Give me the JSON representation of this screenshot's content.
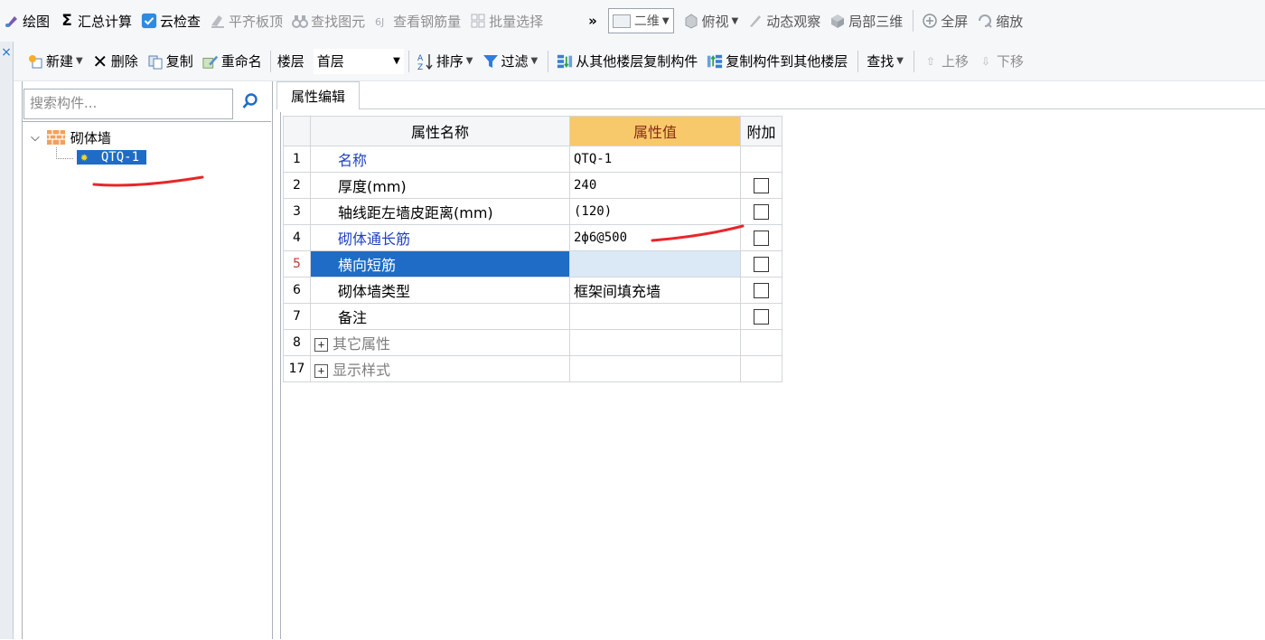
{
  "toolbar1": {
    "items": [
      {
        "label": "绘图",
        "icon": "draw-icon",
        "disabled": false
      },
      {
        "label": "汇总计算",
        "icon": "sigma-icon",
        "disabled": false
      },
      {
        "label": "云检查",
        "icon": "cloud-check-icon",
        "disabled": false
      },
      {
        "label": "平齐板顶",
        "icon": "align-slab-icon",
        "disabled": true
      },
      {
        "label": "查找图元",
        "icon": "binoculars-icon",
        "disabled": true
      },
      {
        "label": "查看钢筋量",
        "icon": "rebar-view-icon",
        "disabled": true
      },
      {
        "label": "批量选择",
        "icon": "batch-select-icon",
        "disabled": true
      }
    ],
    "overflow": "»",
    "view_mode": "二维",
    "view_items": [
      {
        "label": "俯视",
        "icon": "top-view-icon",
        "has_caret": true
      },
      {
        "label": "动态观察",
        "icon": "orbit-icon",
        "has_caret": false
      },
      {
        "label": "局部三维",
        "icon": "local-3d-icon",
        "has_caret": false
      },
      {
        "label": "全屏",
        "icon": "fullscreen-icon",
        "has_caret": false
      },
      {
        "label": "缩放",
        "icon": "zoom-icon",
        "has_caret": false
      }
    ]
  },
  "toolbar2": {
    "new": "新建",
    "delete": "删除",
    "copy": "复制",
    "rename": "重命名",
    "floor_label": "楼层",
    "floor_value": "首层",
    "sort": "排序",
    "filter": "过滤",
    "copy_from": "从其他楼层复制构件",
    "copy_to": "复制构件到其他楼层",
    "find": "查找",
    "move_up": "上移",
    "move_down": "下移"
  },
  "sidebar": {
    "close_glyph": "×",
    "search_placeholder": "搜索构件...",
    "tree_root": "砌体墙",
    "tree_child": "QTQ-1"
  },
  "panel": {
    "tab": "属性编辑",
    "headers": {
      "name": "属性名称",
      "value": "属性值",
      "extra": "附加"
    },
    "rows": [
      {
        "num": "1",
        "name": "名称",
        "value": "QTQ-1",
        "style": "blue",
        "checkbox": false
      },
      {
        "num": "2",
        "name": "厚度(mm)",
        "value": "240",
        "style": "normal",
        "checkbox": true
      },
      {
        "num": "3",
        "name": "轴线距左墙皮距离(mm)",
        "value": "(120)",
        "style": "normal",
        "checkbox": true
      },
      {
        "num": "4",
        "name": "砌体通长筋",
        "value": "2ф6@500",
        "style": "blue",
        "checkbox": true
      },
      {
        "num": "5",
        "name": "横向短筋",
        "value": "",
        "style": "selected",
        "checkbox": true
      },
      {
        "num": "6",
        "name": "砌体墙类型",
        "value": "框架间填充墙",
        "style": "normal",
        "checkbox": true
      },
      {
        "num": "7",
        "name": "备注",
        "value": "",
        "style": "normal",
        "checkbox": true
      },
      {
        "num": "8",
        "name": "其它属性",
        "value": "",
        "style": "group",
        "checkbox": false
      },
      {
        "num": "17",
        "name": "显示样式",
        "value": "",
        "style": "group",
        "checkbox": false
      }
    ]
  },
  "colors": {
    "selection": "#1e6cc6",
    "header_value_bg": "#f7c96a",
    "link_text": "#1f3fc8",
    "annotation": "#e8262a"
  }
}
